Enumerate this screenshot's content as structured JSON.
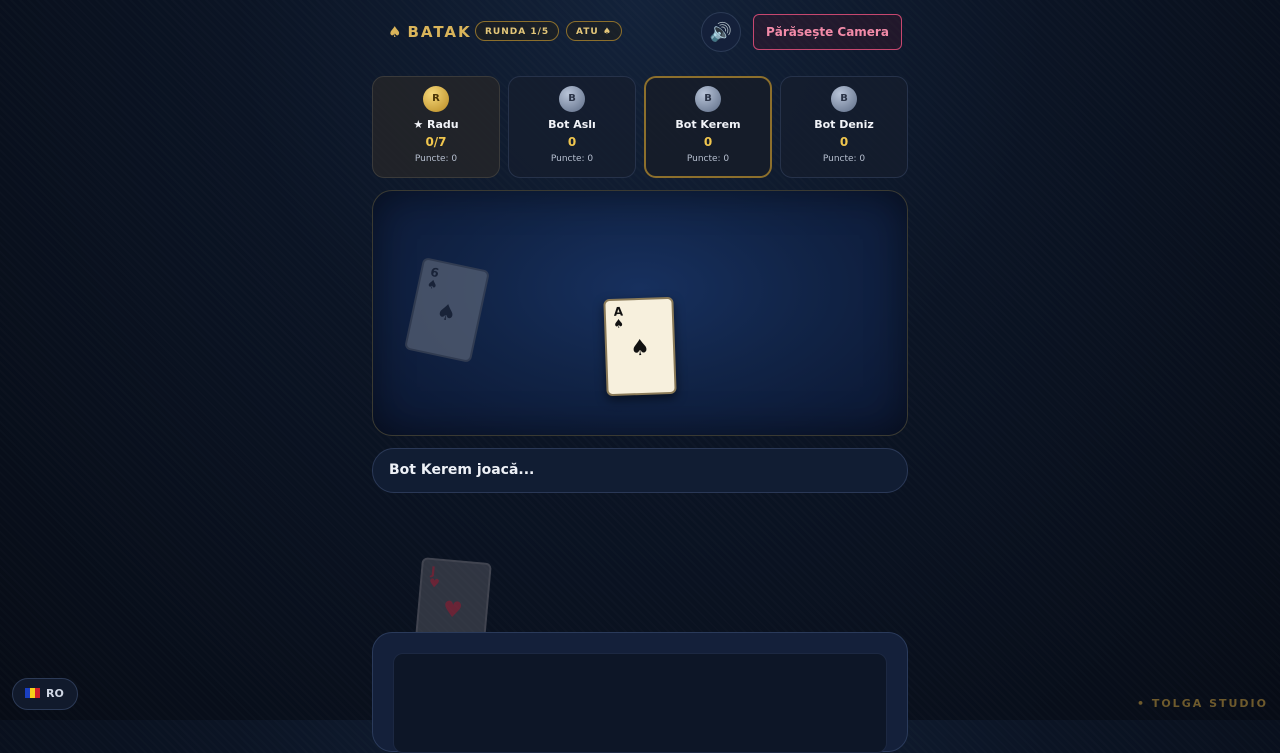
{
  "header": {
    "spade_glyph": "♠",
    "title": "BATAK",
    "round_label": "RUNDA 1/5",
    "trump_label": "ATU ♠",
    "sound_icon": "🔊",
    "leave_label": "Părăsește Camera"
  },
  "players": [
    {
      "initial": "R",
      "name": "★ Radu",
      "score": "0/7",
      "points": "Puncte: 0"
    },
    {
      "initial": "B",
      "name": "Bot Aslı",
      "score": "0",
      "points": "Puncte: 0"
    },
    {
      "initial": "B",
      "name": "Bot Kerem",
      "score": "0",
      "points": "Puncte: 0"
    },
    {
      "initial": "B",
      "name": "Bot Deniz",
      "score": "0",
      "points": "Puncte: 0"
    }
  ],
  "table": {
    "faded_card": {
      "rank": "6",
      "suit": "♠"
    },
    "played_card": {
      "rank": "A",
      "suit": "♠"
    }
  },
  "status_text": "Bot Kerem joacă...",
  "floating_card": {
    "rank": "J",
    "suit": "♥"
  },
  "language": {
    "code": "RO"
  },
  "footer": {
    "studio": "• TOLGA STUDIO"
  },
  "colors": {
    "accent_gold": "#d9b45a",
    "leave_pink": "#f28aa8",
    "table_blue": "#17305e"
  }
}
